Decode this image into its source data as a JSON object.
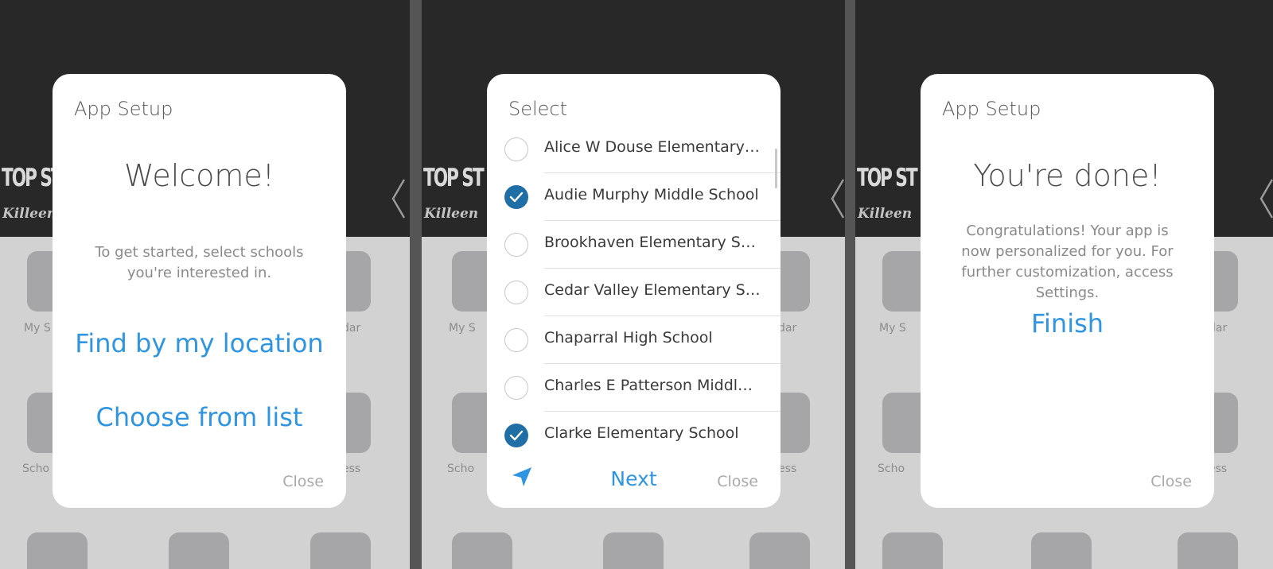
{
  "screens": [
    {
      "card": {
        "title": "App Setup",
        "heading": "Welcome!",
        "description": "To get started, select schools you're interested in.",
        "find_by_location": "Find by my location",
        "choose_from_list": "Choose from list",
        "close": "Close"
      }
    },
    {
      "card": {
        "title": "Select",
        "schools": [
          {
            "name": "Alice W Douse Elementary Sch...",
            "selected": false
          },
          {
            "name": "Audie Murphy Middle School",
            "selected": true
          },
          {
            "name": "Brookhaven Elementary School",
            "selected": false
          },
          {
            "name": "Cedar Valley Elementary School",
            "selected": false
          },
          {
            "name": "Chaparral High School",
            "selected": false
          },
          {
            "name": "Charles E Patterson Middle Sc...",
            "selected": false
          },
          {
            "name": "Clarke Elementary School",
            "selected": true
          }
        ],
        "next": "Next",
        "close": "Close",
        "location_icon": "location-arrow-icon"
      }
    },
    {
      "card": {
        "title": "App Setup",
        "heading": "You're done!",
        "description": "Congratulations! Your app is now personalized for you. For further customization, access Settings.",
        "finish": "Finish",
        "close": "Close"
      }
    }
  ],
  "colors": {
    "accent": "#2f95e0",
    "checked": "#1f6fa6",
    "header_bg": "#282828",
    "body_bg": "#d2d2d2"
  }
}
